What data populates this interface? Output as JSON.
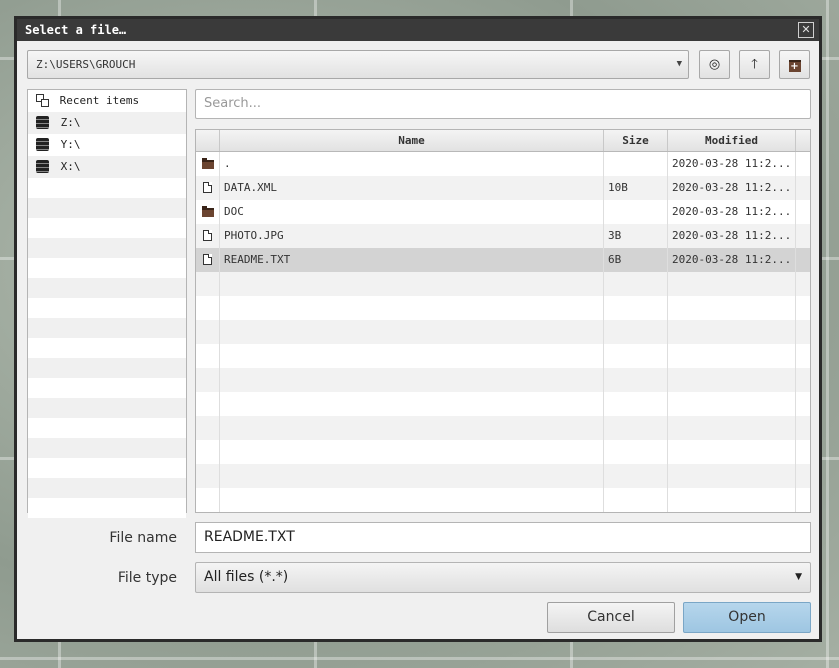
{
  "dialog": {
    "title": "Select a file…",
    "close_symbol": "✕"
  },
  "path": {
    "value": "Z:\\USERS\\GROUCH",
    "arrow": "▼"
  },
  "toolbar": {
    "goto_icon": "◎",
    "up_icon": "🡑",
    "newfolder_icon": "+"
  },
  "sidebar": {
    "items": [
      {
        "label": "Recent items",
        "icon": "recent-items-icon"
      },
      {
        "label": "Z:\\",
        "icon": "drive-icon"
      },
      {
        "label": "Y:\\",
        "icon": "drive-icon"
      },
      {
        "label": "X:\\",
        "icon": "drive-icon"
      }
    ]
  },
  "search": {
    "placeholder": "Search..."
  },
  "columns": {
    "name": "Name",
    "size": "Size",
    "modified": "Modified"
  },
  "files": [
    {
      "name": ".",
      "size": "",
      "modified": "2020-03-28 11:2...",
      "type": "folder"
    },
    {
      "name": "DATA.XML",
      "size": "10B",
      "modified": "2020-03-28 11:2...",
      "type": "file"
    },
    {
      "name": "DOC",
      "size": "",
      "modified": "2020-03-28 11:2...",
      "type": "folder"
    },
    {
      "name": "PHOTO.JPG",
      "size": "3B",
      "modified": "2020-03-28 11:2...",
      "type": "file"
    },
    {
      "name": "README.TXT",
      "size": "6B",
      "modified": "2020-03-28 11:2...",
      "type": "file",
      "selected": true
    }
  ],
  "filename": {
    "label": "File name",
    "value": "README.TXT"
  },
  "filetype": {
    "label": "File type",
    "value": "All files (*.*)",
    "arrow": "▼"
  },
  "buttons": {
    "cancel": "Cancel",
    "open": "Open"
  },
  "colors": {
    "selection": "#d3d3d3",
    "open_button": "#a8cce6",
    "titlebar": "#3a3a3a",
    "folder": "#6b4430"
  }
}
